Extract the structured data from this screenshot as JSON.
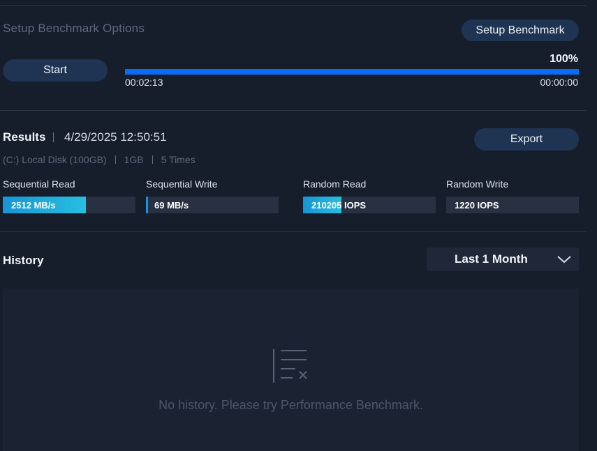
{
  "setup": {
    "title": "Setup Benchmark Options",
    "setup_button_label": "Setup Benchmark",
    "start_button_label": "Start"
  },
  "progress": {
    "percent_label": "100%",
    "fill_fraction": 1.0,
    "elapsed": "00:02:13",
    "remaining": "00:00:00"
  },
  "results": {
    "title": "Results",
    "datetime": "4/29/2025 12:50:51",
    "export_button_label": "Export",
    "drive": "(C:) Local Disk (100GB)",
    "size": "1GB",
    "times": "5 Times",
    "metrics": [
      {
        "label": "Sequential Read",
        "value": "2512 MB/s",
        "fill_fraction": 0.625
      },
      {
        "label": "Sequential Write",
        "value": "69 MB/s",
        "fill_fraction": 0.017
      },
      {
        "label": "Random Read",
        "value": "210205 IOPS",
        "fill_fraction": 0.29
      },
      {
        "label": "Random Write",
        "value": "1220 IOPS",
        "fill_fraction": 0.0
      }
    ]
  },
  "history": {
    "title": "History",
    "range_selected": "Last 1 Month",
    "empty_message": "No history. Please try Performance Benchmark."
  },
  "colors": {
    "background": "#161d2b",
    "accent_blue": "#0a6cf5",
    "metric_fill": "#27bfe0",
    "button_bg": "#1f3352"
  },
  "icons": {
    "dropdown": "chevron-down-icon",
    "empty_history": "list-remove-icon"
  }
}
